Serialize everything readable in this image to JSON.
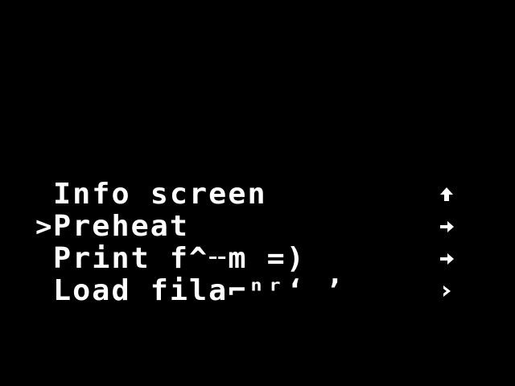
{
  "colors": {
    "background": "#000000",
    "foreground": "#ffffff"
  },
  "menu": {
    "cursor_glyph": ">",
    "items": [
      {
        "label": "Info screen",
        "selected": false,
        "icon": "up-arrow-icon"
      },
      {
        "label": "Preheat",
        "selected": true,
        "icon": "right-arrow-icon"
      },
      {
        "label": "Print f^╌m =)",
        "selected": false,
        "icon": "right-arrow-icon"
      },
      {
        "label": "Load fila⌐ⁿʳʻ ʼ",
        "selected": false,
        "icon": "chevron-right-icon"
      }
    ]
  }
}
